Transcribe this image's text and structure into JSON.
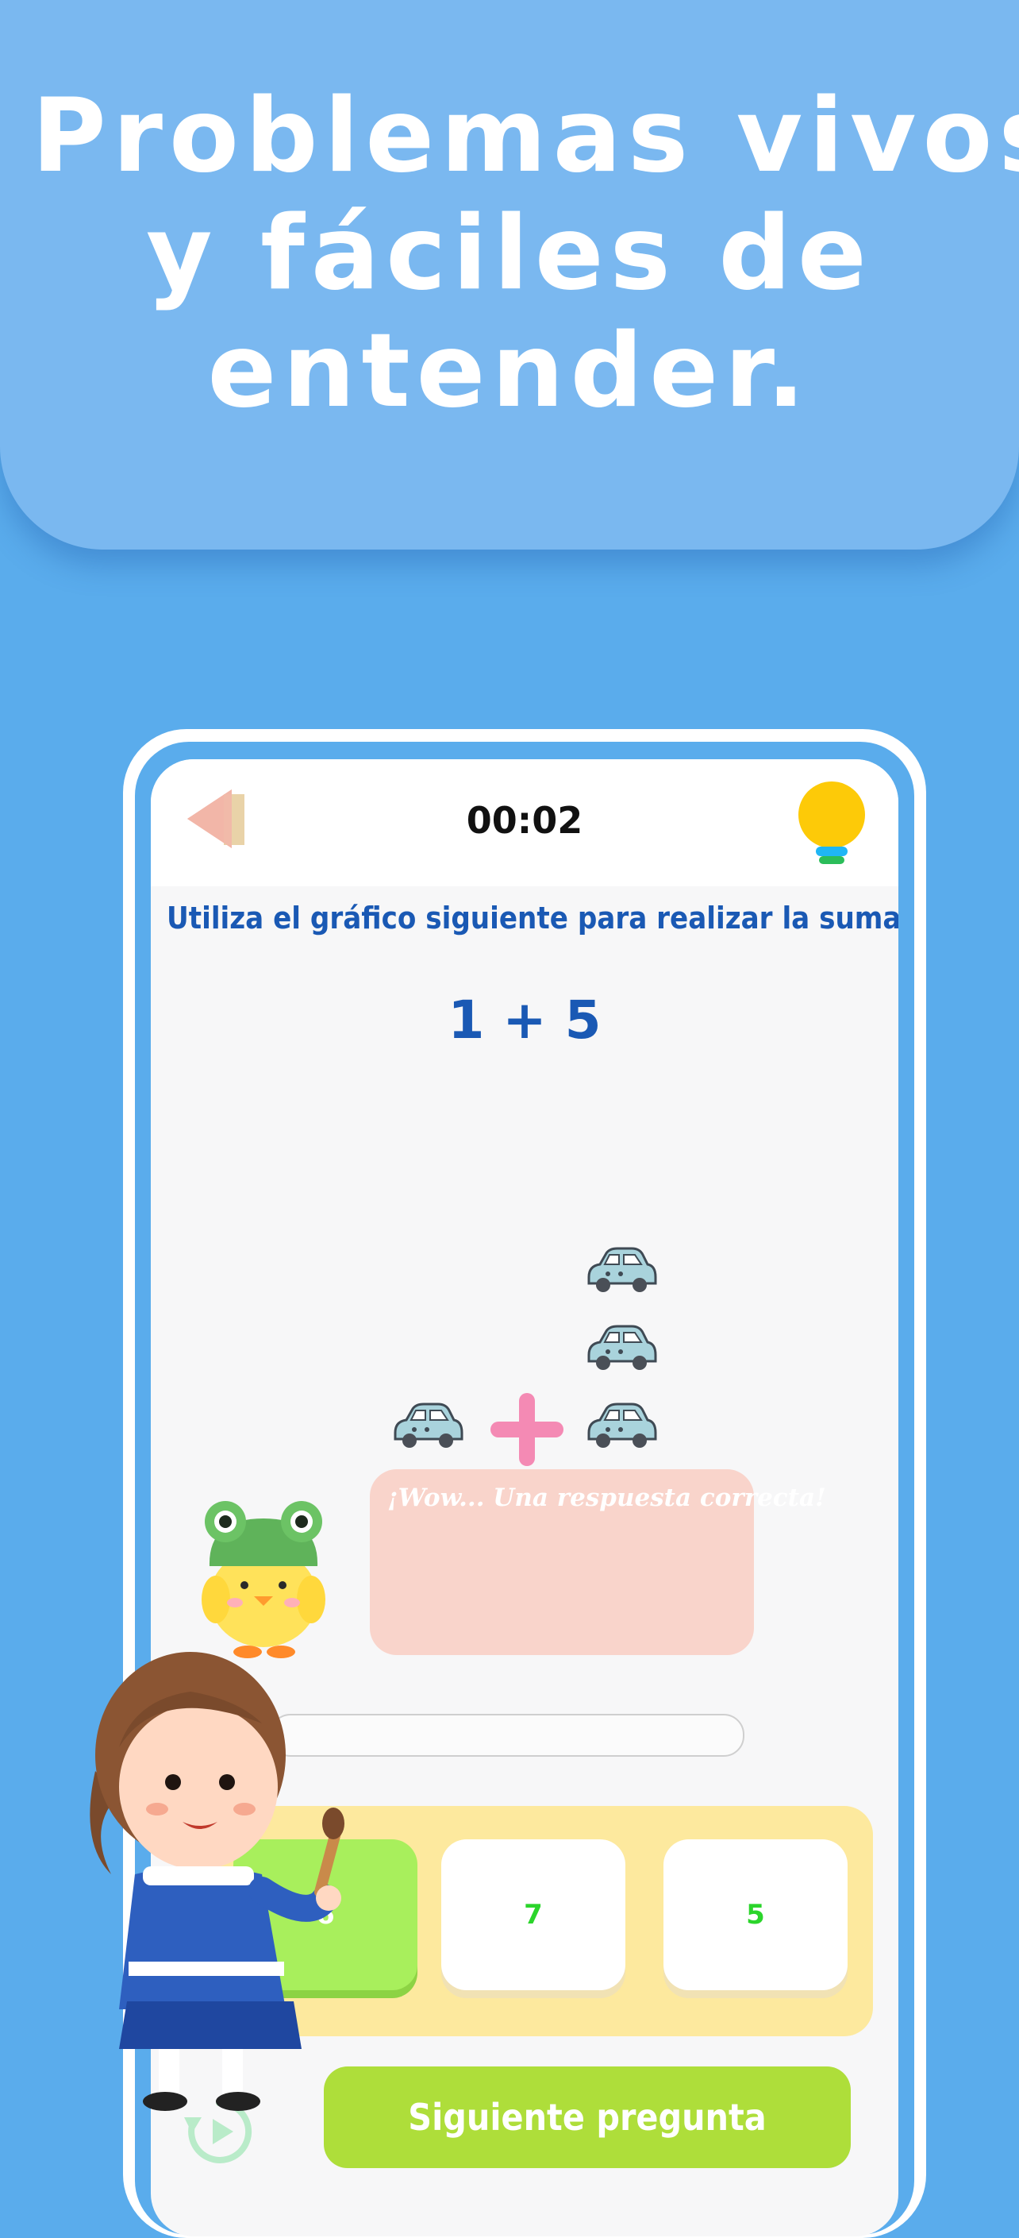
{
  "banner": {
    "headline_lines": [
      "Problemas vivos",
      "y fáciles de",
      "entender."
    ]
  },
  "app": {
    "timer": "00:02",
    "question": "Utiliza el gráfico siguiente para realizar la suma.",
    "equation": "1 + 5",
    "feedback": "¡Wow... Una respuesta correcta!",
    "options": [
      {
        "label": "6",
        "selected": true
      },
      {
        "label": "7",
        "selected": false
      },
      {
        "label": "5",
        "selected": false
      }
    ],
    "next_button": "Siguiente pregunta"
  },
  "colors": {
    "background": "#5aacec",
    "banner": "#7ab8f0",
    "title_blue": "#1a59b4",
    "next_green": "#aede3a",
    "option_text_green": "#2bd52b",
    "feedback_pink": "#f9d4cb",
    "options_panel": "#fde99e"
  },
  "icons": {
    "back": "back-arrow-icon",
    "hint": "lightbulb-icon",
    "car": "car-icon",
    "plus": "plus-icon",
    "replay": "replay-icon"
  }
}
